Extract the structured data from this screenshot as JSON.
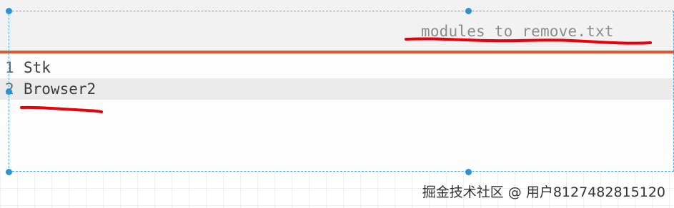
{
  "editor": {
    "tab_title": "modules_to_remove.txt",
    "lines": [
      {
        "number": "1",
        "text": "Stk"
      },
      {
        "number": "2",
        "text": "Browser2"
      }
    ],
    "current_line": 2
  },
  "watermark": "掘金技术社区 @ 用户8127482815120",
  "colors": {
    "accent": "#e0582b",
    "annotation": "#e8000b",
    "selection_frame": "#2a93d5"
  }
}
